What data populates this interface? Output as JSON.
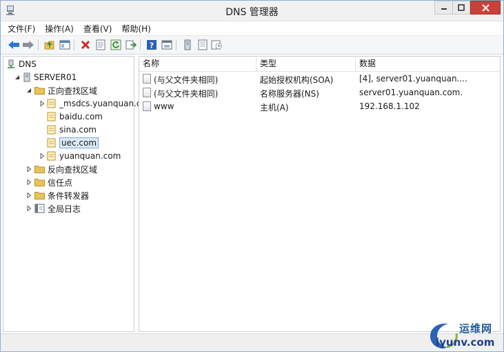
{
  "window": {
    "title": "DNS 管理器",
    "controls": {
      "minimize": "minimize-icon",
      "maximize": "maximize-icon",
      "close": "close-icon"
    }
  },
  "menubar": [
    {
      "label": "文件(F)"
    },
    {
      "label": "操作(A)"
    },
    {
      "label": "查看(V)"
    },
    {
      "label": "帮助(H)"
    }
  ],
  "toolbar": [
    "back-arrow-icon",
    "forward-arrow-icon",
    "up-folder-icon",
    "show-hide-tree-icon",
    "delete-icon",
    "properties-icon",
    "refresh-icon",
    "export-icon",
    "help-icon",
    "console-icon",
    "server-icon",
    "records-icon",
    "schedule-icon"
  ],
  "tree": {
    "root": "DNS",
    "server": "SERVER01",
    "forward_zones": "正向查找区域",
    "zones": [
      "_msdcs.yuanquan.c",
      "baidu.com",
      "sina.com",
      "uec.com",
      "yuanquan.com"
    ],
    "selected": "uec.com",
    "reverse_zones": "反向查找区域",
    "trust_points": "信任点",
    "conditional_forwarders": "条件转发器",
    "global_logs": "全局日志"
  },
  "list": {
    "columns": [
      "名称",
      "类型",
      "数据"
    ],
    "rows": [
      {
        "name": "(与父文件夹相同)",
        "type": "起始授权机构(SOA)",
        "data": "[4], server01.yuanquan...."
      },
      {
        "name": "(与父文件夹相同)",
        "type": "名称服务器(NS)",
        "data": "server01.yuanquan.com."
      },
      {
        "name": "www",
        "type": "主机(A)",
        "data": "192.168.1.102"
      }
    ]
  },
  "watermark": {
    "line1": "运维网",
    "line2": "iyunv.com"
  },
  "colors": {
    "accent": "#c7433a",
    "folder": "#e8c35a",
    "selection": "#dce9f9",
    "arrow_blue": "#2b78d6"
  }
}
